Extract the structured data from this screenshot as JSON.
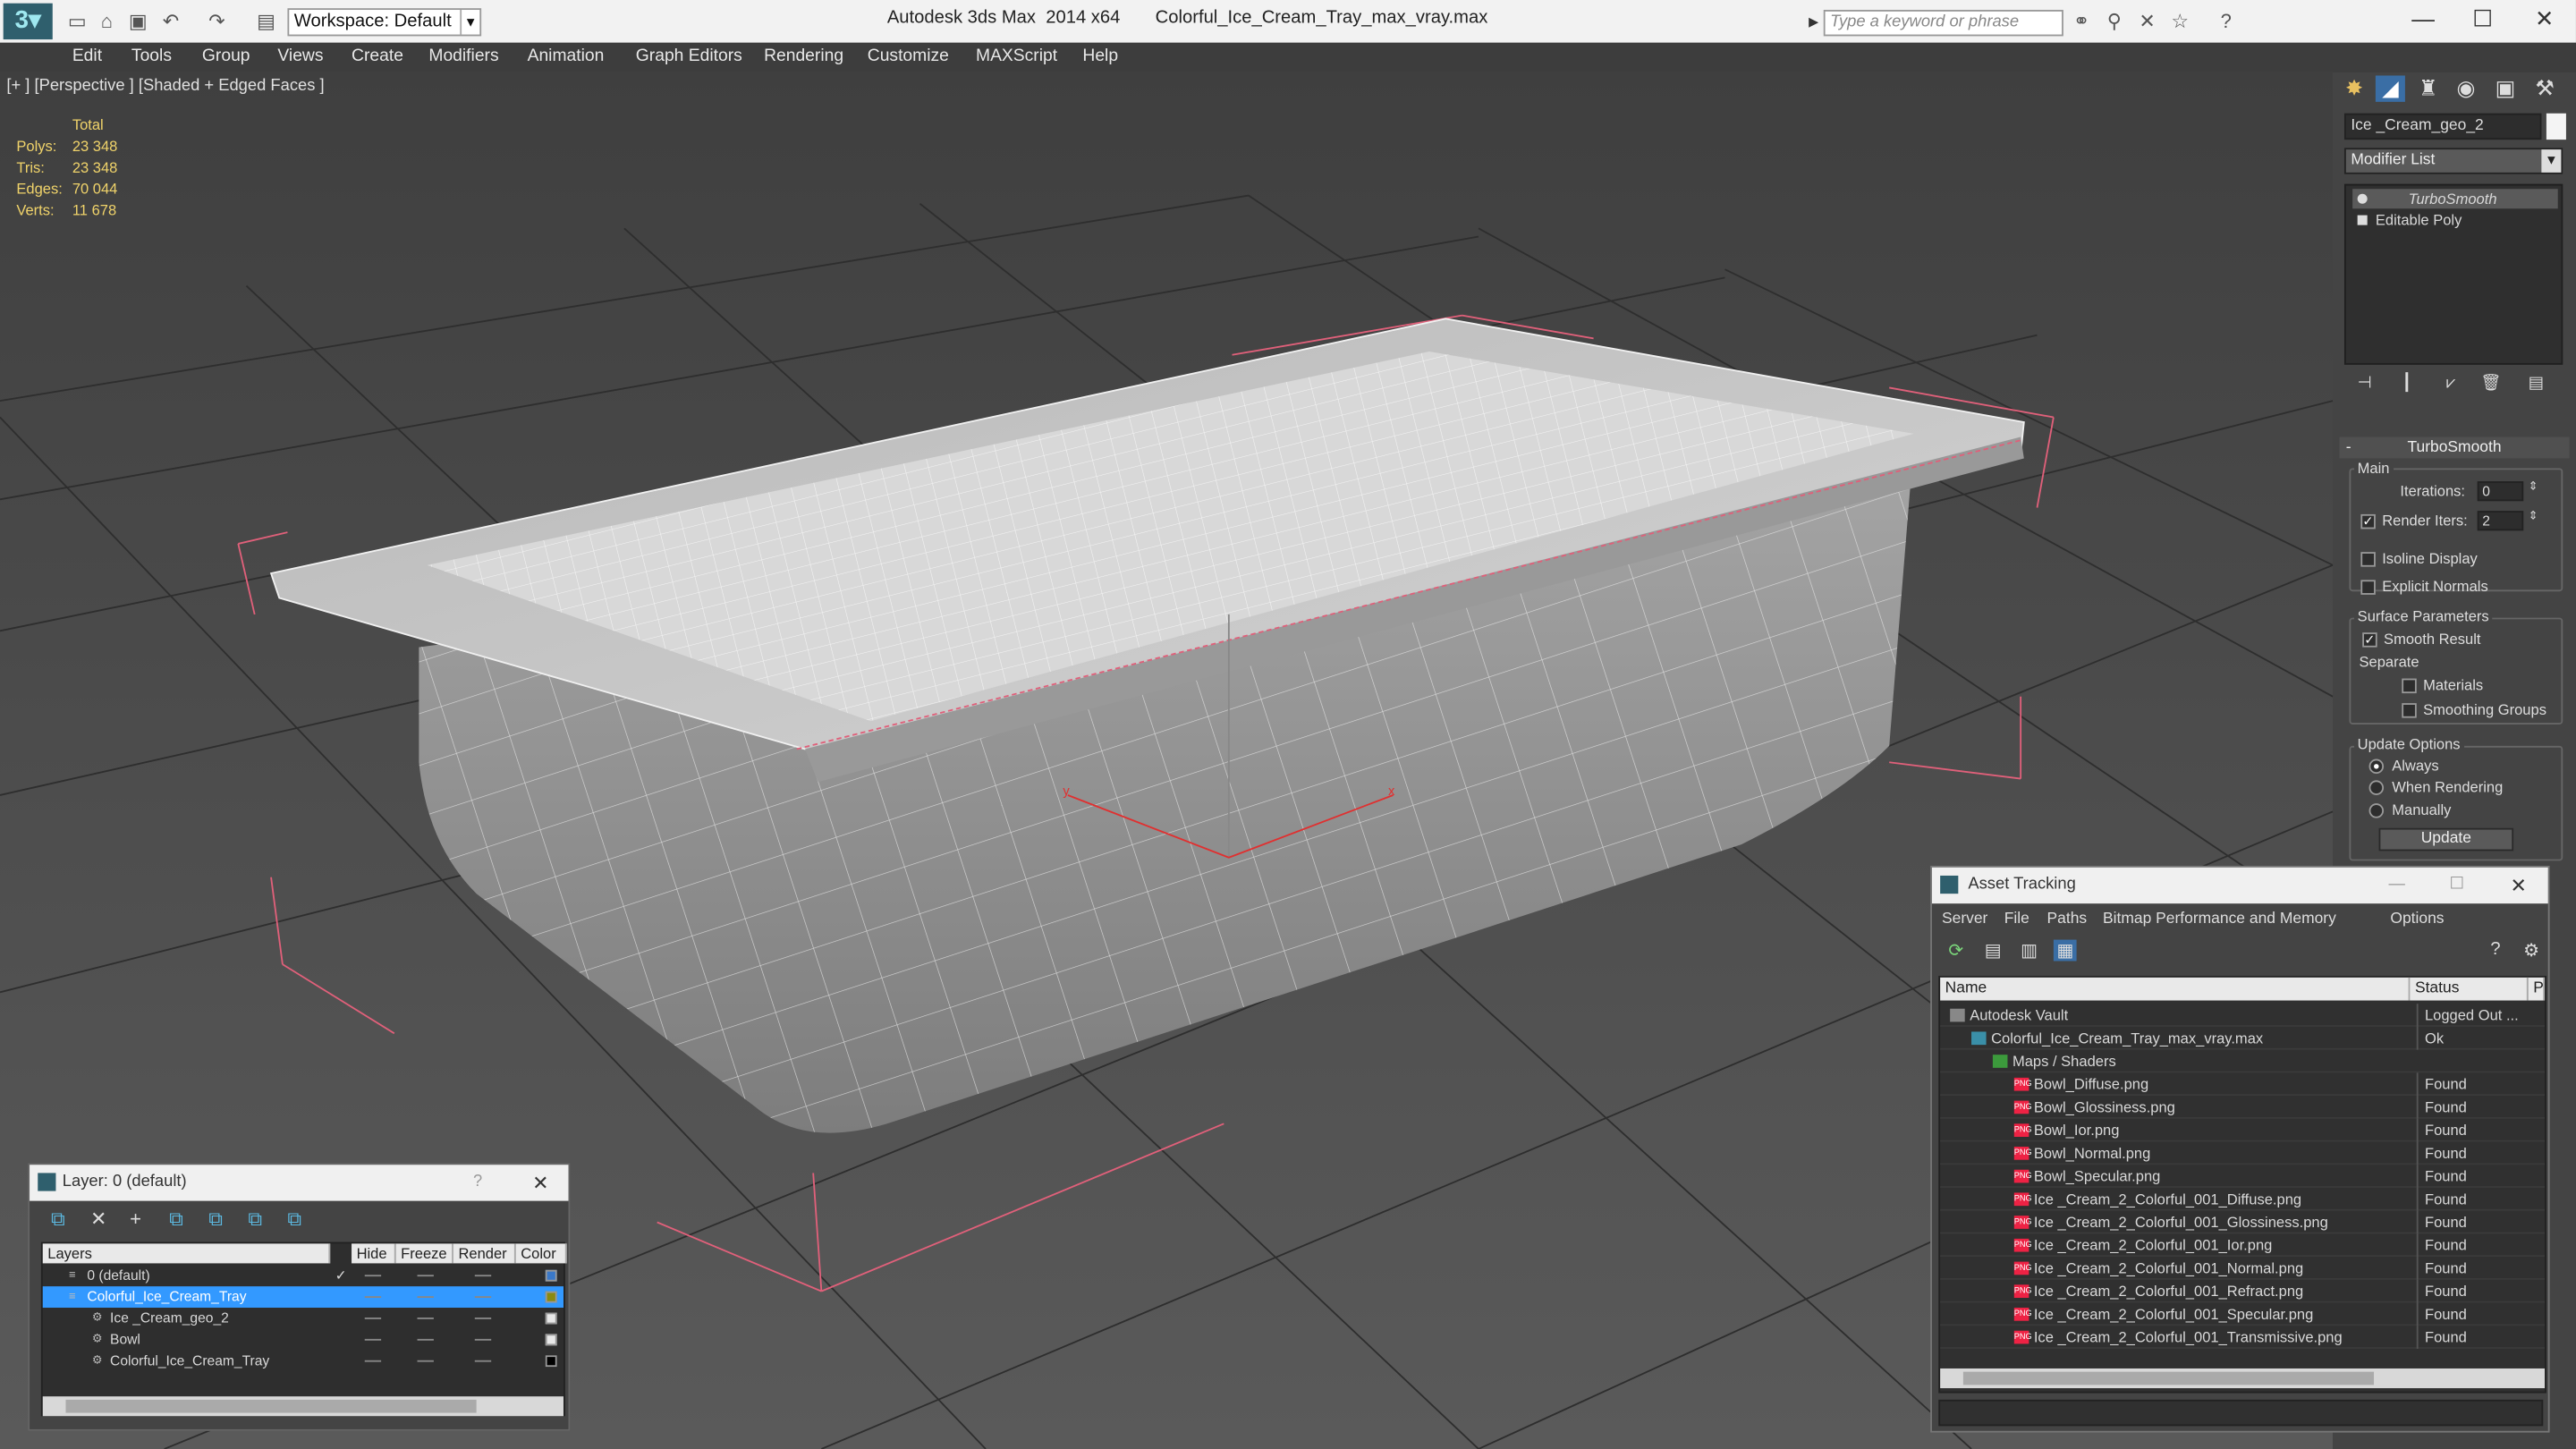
{
  "titlebar": {
    "workspace": "Workspace: Default",
    "app_title": "Autodesk 3ds Max  2014 x64       Colorful_Ice_Cream_Tray_max_vray.max",
    "search_placeholder": "Type a keyword or phrase"
  },
  "menu": [
    "Edit",
    "Tools",
    "Group",
    "Views",
    "Create",
    "Modifiers",
    "Animation",
    "Graph Editors",
    "Rendering",
    "Customize",
    "MAXScript",
    "Help"
  ],
  "viewport": {
    "label": "[+ ] [Perspective ] [Shaded + Edged Faces ]",
    "stats": {
      "header": "Total",
      "rows": [
        {
          "label": "Polys:",
          "value": "23 348"
        },
        {
          "label": "Tris:",
          "value": "23 348"
        },
        {
          "label": "Edges:",
          "value": "70 044"
        },
        {
          "label": "Verts:",
          "value": "11 678"
        }
      ]
    }
  },
  "command_panel": {
    "object_name": "Ice _Cream_geo_2",
    "modifier_list": "Modifier List",
    "stack": [
      {
        "label": "TurboSmooth",
        "italic": true,
        "active": true
      },
      {
        "label": "Editable Poly",
        "italic": false,
        "active": false
      }
    ],
    "turbosmooth": {
      "title": "TurboSmooth",
      "main_label": "Main",
      "iterations_label": "Iterations:",
      "iterations_value": "0",
      "render_iters_label": "Render Iters:",
      "render_iters_value": "2",
      "render_iters_checked": true,
      "isoline_label": "Isoline Display",
      "explicit_label": "Explicit Normals",
      "surface_label": "Surface Parameters",
      "smooth_result_label": "Smooth Result",
      "separate_label": "Separate",
      "materials_label": "Materials",
      "smoothing_groups_label": "Smoothing Groups",
      "update_options_label": "Update Options",
      "always_label": "Always",
      "when_rendering_label": "When Rendering",
      "manually_label": "Manually",
      "update_button": "Update"
    }
  },
  "layer_window": {
    "title": "Layer: 0 (default)",
    "help": "?",
    "columns": [
      "Layers",
      "Hide",
      "Freeze",
      "Render",
      "Color"
    ],
    "rows": [
      {
        "name": "0 (default)",
        "indent": 0,
        "selected": false,
        "color": "#3a78c8"
      },
      {
        "name": "Colorful_Ice_Cream_Tray",
        "indent": 0,
        "selected": true,
        "color": "#8a8a10"
      },
      {
        "name": "Ice _Cream_geo_2",
        "indent": 1,
        "selected": false,
        "color": "#e8e8e8"
      },
      {
        "name": "Bowl",
        "indent": 1,
        "selected": false,
        "color": "#e8e8e8"
      },
      {
        "name": "Colorful_Ice_Cream_Tray",
        "indent": 1,
        "selected": false,
        "color": "#000000"
      }
    ]
  },
  "asset_window": {
    "title": "Asset Tracking",
    "menu": [
      "Server",
      "File",
      "Paths",
      "Bitmap Performance and Memory",
      "Options"
    ],
    "columns": [
      "Name",
      "Status",
      "P"
    ],
    "rows": [
      {
        "name": "Autodesk Vault",
        "status": "Logged Out ...",
        "indent": 0,
        "kind": "vault"
      },
      {
        "name": "Colorful_Ice_Cream_Tray_max_vray.max",
        "status": "Ok",
        "indent": 1,
        "kind": "max"
      },
      {
        "name": "Maps / Shaders",
        "status": "",
        "indent": 2,
        "kind": "folder"
      },
      {
        "name": "Bowl_Diffuse.png",
        "status": "Found",
        "indent": 3,
        "kind": "png"
      },
      {
        "name": "Bowl_Glossiness.png",
        "status": "Found",
        "indent": 3,
        "kind": "png"
      },
      {
        "name": "Bowl_Ior.png",
        "status": "Found",
        "indent": 3,
        "kind": "png"
      },
      {
        "name": "Bowl_Normal.png",
        "status": "Found",
        "indent": 3,
        "kind": "png"
      },
      {
        "name": "Bowl_Specular.png",
        "status": "Found",
        "indent": 3,
        "kind": "png"
      },
      {
        "name": "Ice _Cream_2_Colorful_001_Diffuse.png",
        "status": "Found",
        "indent": 3,
        "kind": "png"
      },
      {
        "name": "Ice _Cream_2_Colorful_001_Glossiness.png",
        "status": "Found",
        "indent": 3,
        "kind": "png"
      },
      {
        "name": "Ice _Cream_2_Colorful_001_Ior.png",
        "status": "Found",
        "indent": 3,
        "kind": "png"
      },
      {
        "name": "Ice _Cream_2_Colorful_001_Normal.png",
        "status": "Found",
        "indent": 3,
        "kind": "png"
      },
      {
        "name": "Ice _Cream_2_Colorful_001_Refract.png",
        "status": "Found",
        "indent": 3,
        "kind": "png"
      },
      {
        "name": "Ice _Cream_2_Colorful_001_Specular.png",
        "status": "Found",
        "indent": 3,
        "kind": "png"
      },
      {
        "name": "Ice _Cream_2_Colorful_001_Transmissive.png",
        "status": "Found",
        "indent": 3,
        "kind": "png"
      }
    ]
  },
  "colors": {
    "accent": "#3399ff",
    "stats": "#f0d36a",
    "selection_red": "#e0607a",
    "viewport_bg": "#4d4d4d"
  }
}
